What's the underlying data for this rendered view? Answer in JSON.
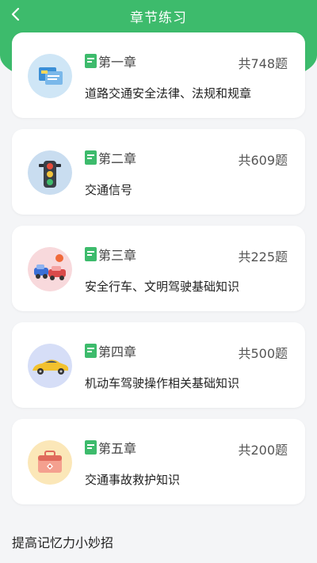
{
  "header": {
    "title": "章节练习",
    "accent_color": "#3dbb6c"
  },
  "chapters": [
    {
      "label": "第一章",
      "count": "共748题",
      "subject": "道路交通安全法律、法规和规章",
      "icon": "documents-icon"
    },
    {
      "label": "第二章",
      "count": "共609题",
      "subject": "交通信号",
      "icon": "traffic-light-icon"
    },
    {
      "label": "第三章",
      "count": "共225题",
      "subject": "安全行车、文明驾驶基础知识",
      "icon": "car-accident-icon"
    },
    {
      "label": "第四章",
      "count": "共500题",
      "subject": "机动车驾驶操作相关基础知识",
      "icon": "yellow-car-icon"
    },
    {
      "label": "第五章",
      "count": "共200题",
      "subject": "交通事故救护知识",
      "icon": "first-aid-kit-icon"
    }
  ],
  "tips_heading": "提高记忆力小妙招"
}
